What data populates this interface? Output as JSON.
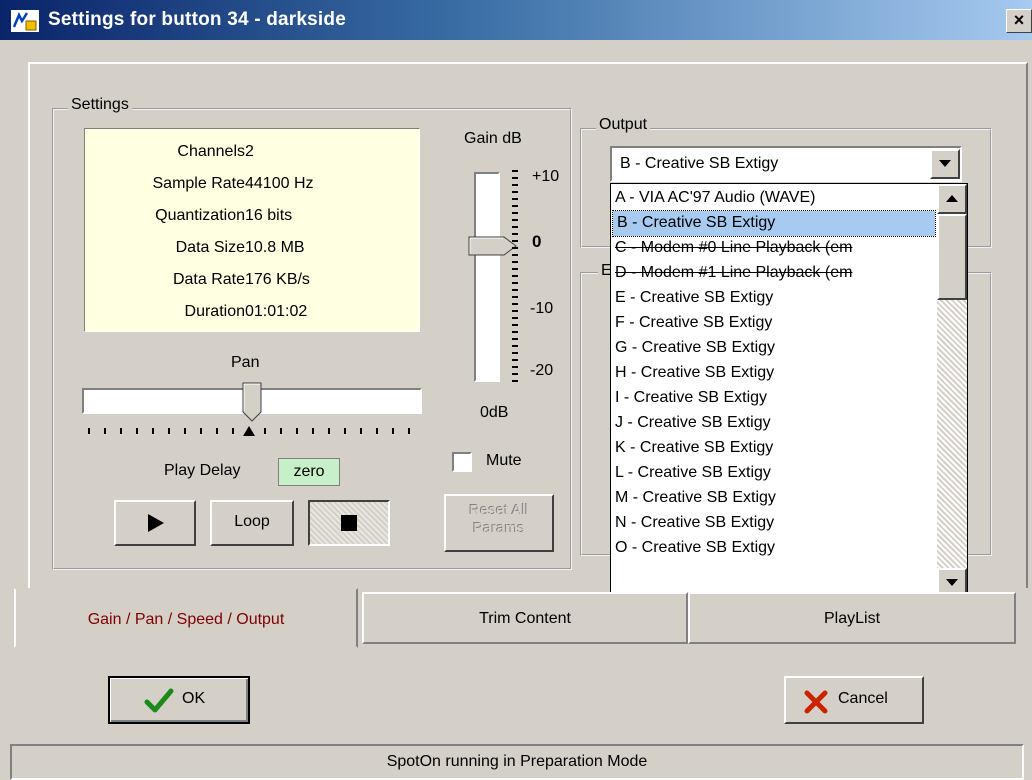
{
  "window": {
    "title": "Settings for button 34 - darkside",
    "close_label": "×"
  },
  "settings_group": {
    "legend": "Settings",
    "info": [
      {
        "label": "Channels",
        "value": "2"
      },
      {
        "label": "Sample Rate",
        "value": "44100 Hz"
      },
      {
        "label": "Quantization",
        "value": "16 bits"
      },
      {
        "label": "Data Size",
        "value": "10.8 MB"
      },
      {
        "label": "Data Rate",
        "value": "176 KB/s"
      },
      {
        "label": "Duration",
        "value": "01:01:02"
      }
    ],
    "pan_label": "Pan",
    "pan_position": 0.5,
    "play_delay_label": "Play Delay",
    "play_delay_value": "zero",
    "play_icon": "play-icon",
    "loop_label": "Loop",
    "stop_icon": "stop-icon"
  },
  "gain": {
    "label": "Gain dB",
    "scale": [
      "+10",
      "0",
      "-10",
      "-20"
    ],
    "value_label": "0dB",
    "mute_label": "Mute",
    "mute_checked": false,
    "reset_label_line1": "Reset All",
    "reset_label_line2": "Params"
  },
  "output": {
    "legend": "Output",
    "selected": "B  - Creative SB Extigy",
    "second_legend_partial": "E",
    "options": [
      {
        "text": "A  - VIA AC'97 Audio (WAVE)",
        "struck": false,
        "highlighted": false
      },
      {
        "text": "B  - Creative SB Extigy",
        "struck": false,
        "highlighted": true
      },
      {
        "text": "C  - Modem #0 Line Playback (em",
        "struck": true,
        "highlighted": false
      },
      {
        "text": "D  - Modem #1 Line Playback (em",
        "struck": true,
        "highlighted": false
      },
      {
        "text": "E  - Creative SB Extigy",
        "struck": false,
        "highlighted": false
      },
      {
        "text": "F  - Creative SB Extigy",
        "struck": false,
        "highlighted": false
      },
      {
        "text": "G  - Creative SB Extigy",
        "struck": false,
        "highlighted": false
      },
      {
        "text": "H  - Creative SB Extigy",
        "struck": false,
        "highlighted": false
      },
      {
        "text": "I   - Creative SB Extigy",
        "struck": false,
        "highlighted": false
      },
      {
        "text": "J  - Creative SB Extigy",
        "struck": false,
        "highlighted": false
      },
      {
        "text": "K  - Creative SB Extigy",
        "struck": false,
        "highlighted": false
      },
      {
        "text": "L  - Creative SB Extigy",
        "struck": false,
        "highlighted": false
      },
      {
        "text": "M  - Creative SB Extigy",
        "struck": false,
        "highlighted": false
      },
      {
        "text": "N  - Creative SB Extigy",
        "struck": false,
        "highlighted": false
      },
      {
        "text": "O  - Creative SB Extigy",
        "struck": false,
        "highlighted": false
      }
    ]
  },
  "tabs": [
    {
      "label": "Gain / Pan / Speed / Output",
      "active": true
    },
    {
      "label": "Trim Content",
      "active": false
    },
    {
      "label": "PlayList",
      "active": false
    }
  ],
  "footer": {
    "ok_label": "OK",
    "cancel_label": "Cancel",
    "status": "SpotOn running in Preparation Mode"
  },
  "colors": {
    "face": "#d4d0c8",
    "info_bg": "#ffffe1",
    "selection": "#a6caf0",
    "active_tab_text": "#800000",
    "play_delay_bg": "#c8f0c8",
    "ok_check": "#1a8a1a",
    "cancel_x": "#cc2200"
  }
}
